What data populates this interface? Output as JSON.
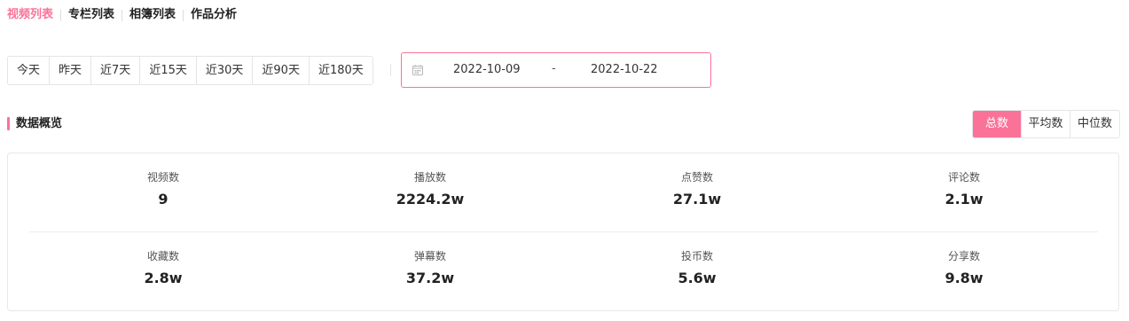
{
  "tabs": [
    {
      "label": "视频列表",
      "active": true
    },
    {
      "label": "专栏列表",
      "active": false
    },
    {
      "label": "相簿列表",
      "active": false
    },
    {
      "label": "作品分析",
      "active": false
    }
  ],
  "quick_ranges": [
    "今天",
    "昨天",
    "近7天",
    "近15天",
    "近30天",
    "近90天",
    "近180天"
  ],
  "date_range": {
    "start": "2022-10-09",
    "separator": "-",
    "end": "2022-10-22"
  },
  "section": {
    "title": "数据概览"
  },
  "modes": [
    {
      "label": "总数",
      "active": true
    },
    {
      "label": "平均数",
      "active": false
    },
    {
      "label": "中位数",
      "active": false
    }
  ],
  "stats": {
    "row1": [
      {
        "label": "视频数",
        "value": "9"
      },
      {
        "label": "播放数",
        "value": "2224.2w"
      },
      {
        "label": "点赞数",
        "value": "27.1w"
      },
      {
        "label": "评论数",
        "value": "2.1w"
      }
    ],
    "row2": [
      {
        "label": "收藏数",
        "value": "2.8w"
      },
      {
        "label": "弹幕数",
        "value": "37.2w"
      },
      {
        "label": "投币数",
        "value": "5.6w"
      },
      {
        "label": "分享数",
        "value": "9.8w"
      }
    ]
  },
  "colors": {
    "accent": "#fb7299",
    "border": "#e3e5e7",
    "text": "#222222"
  }
}
